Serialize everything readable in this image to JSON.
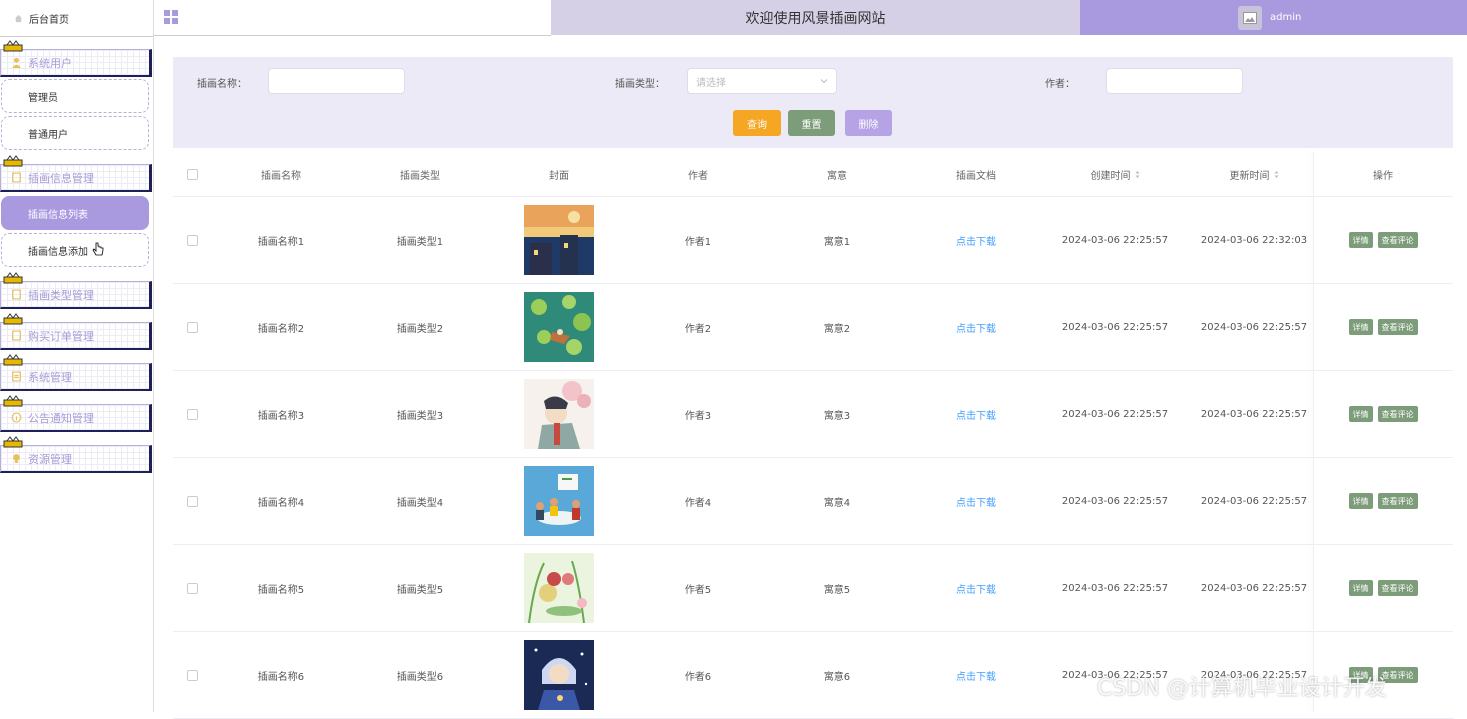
{
  "sidebar": {
    "home": "后台首页",
    "groups": [
      {
        "label": "系统用户",
        "items": [
          "管理员",
          "普通用户"
        ]
      },
      {
        "label": "插画信息管理",
        "items": [
          "插画信息列表",
          "插画信息添加"
        ]
      },
      {
        "label": "插画类型管理",
        "items": []
      },
      {
        "label": "购买订单管理",
        "items": []
      },
      {
        "label": "系统管理",
        "items": []
      },
      {
        "label": "公告通知管理",
        "items": []
      },
      {
        "label": "资源管理",
        "items": []
      }
    ]
  },
  "header": {
    "title": "欢迎使用风景插画网站",
    "user": "admin"
  },
  "search": {
    "name_label": "插画名称：",
    "type_label": "插画类型：",
    "type_placeholder": "请选择",
    "author_label": "作者：",
    "query_button": "查询",
    "reset_button": "重置",
    "delete_button": "删除"
  },
  "colors": {
    "accent": "#a99ae0",
    "query": "#f5a623",
    "reset": "#7d9c7a",
    "delete": "#b5a3e6"
  },
  "table": {
    "columns": [
      "插画名称",
      "插画类型",
      "封面",
      "作者",
      "寓意",
      "插画文档",
      "创建时间",
      "更新时间",
      "操作"
    ],
    "rows": [
      {
        "name": "插画名称1",
        "type": "插画类型1",
        "author": "作者1",
        "meaning": "寓意1",
        "doc": "点击下载",
        "created": "2024-03-06 22:25:57",
        "updated": "2024-03-06 22:32:03",
        "cover": "night-street"
      },
      {
        "name": "插画名称2",
        "type": "插画类型2",
        "author": "作者2",
        "meaning": "寓意2",
        "doc": "点击下载",
        "created": "2024-03-06 22:25:57",
        "updated": "2024-03-06 22:25:57",
        "cover": "lily-pond"
      },
      {
        "name": "插画名称3",
        "type": "插画类型3",
        "author": "作者3",
        "meaning": "寓意3",
        "doc": "点击下载",
        "created": "2024-03-06 22:25:57",
        "updated": "2024-03-06 22:25:57",
        "cover": "blossom-girl"
      },
      {
        "name": "插画名称4",
        "type": "插画类型4",
        "author": "作者4",
        "meaning": "寓意4",
        "doc": "点击下载",
        "created": "2024-03-06 22:25:57",
        "updated": "2024-03-06 22:25:57",
        "cover": "office-meeting"
      },
      {
        "name": "插画名称5",
        "type": "插画类型5",
        "author": "作者5",
        "meaning": "寓意5",
        "doc": "点击下载",
        "created": "2024-03-06 22:25:57",
        "updated": "2024-03-06 22:25:57",
        "cover": "garden"
      },
      {
        "name": "插画名称6",
        "type": "插画类型6",
        "author": "作者6",
        "meaning": "寓意6",
        "doc": "点击下载",
        "created": "2024-03-06 22:25:57",
        "updated": "2024-03-06 22:25:57",
        "cover": "starry-girl"
      }
    ],
    "detail_button": "详情",
    "comment_button": "查看评论"
  },
  "watermark": "CSDN @计算机毕业设计开发"
}
